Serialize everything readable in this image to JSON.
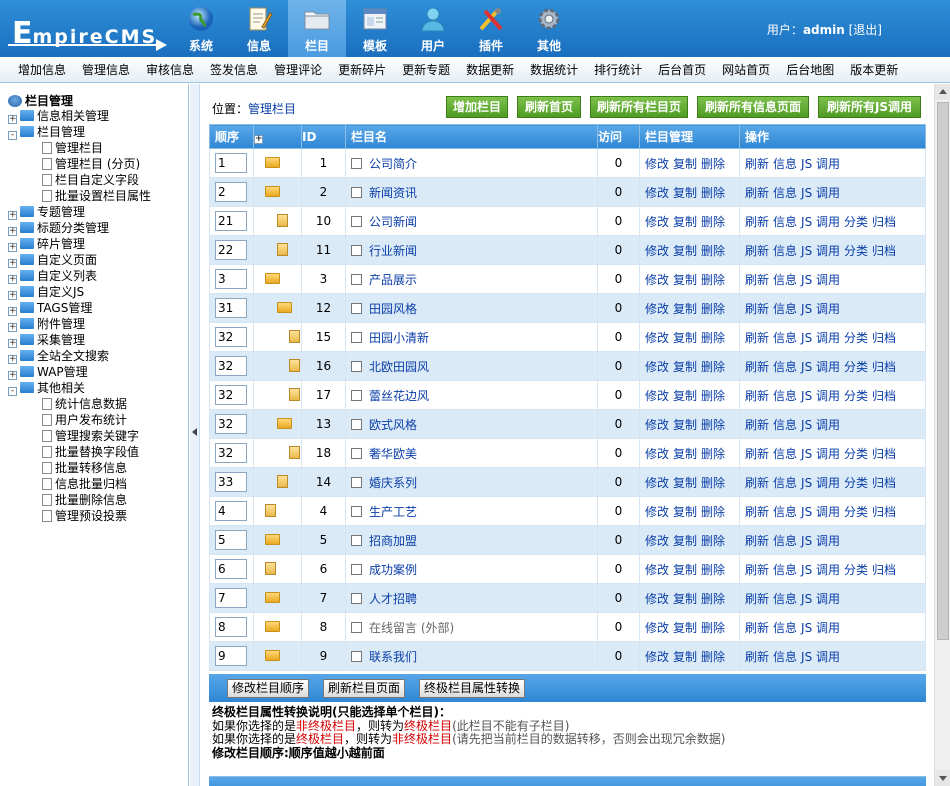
{
  "logo": {
    "text_big": "E",
    "text_rest": "mpireCMS"
  },
  "topnav": [
    {
      "label": "系统",
      "icon": "globe-icon"
    },
    {
      "label": "信息",
      "icon": "document-edit-icon"
    },
    {
      "label": "栏目",
      "icon": "folder-icon",
      "active": true
    },
    {
      "label": "模板",
      "icon": "template-window-icon"
    },
    {
      "label": "用户",
      "icon": "user-icon"
    },
    {
      "label": "插件",
      "icon": "tools-icon"
    },
    {
      "label": "其他",
      "icon": "gear-icon"
    }
  ],
  "user": {
    "label": "用户：",
    "name": "admin",
    "logout": "[退出]"
  },
  "submenu": [
    "增加信息",
    "管理信息",
    "审核信息",
    "签发信息",
    "管理评论",
    "更新碎片",
    "更新专题",
    "数据更新",
    "数据统计",
    "排行统计",
    "后台首页",
    "网站首页",
    "后台地图",
    "版本更新"
  ],
  "sidebar": {
    "title": "栏目管理",
    "items": [
      {
        "label": "信息相关管理",
        "type": "folder",
        "box": "+"
      },
      {
        "label": "栏目管理",
        "type": "folder",
        "box": "-"
      },
      {
        "label": "管理栏目",
        "type": "doc"
      },
      {
        "label": "管理栏目 (分页)",
        "type": "doc"
      },
      {
        "label": "栏目自定义字段",
        "type": "doc"
      },
      {
        "label": "批量设置栏目属性",
        "type": "doc"
      },
      {
        "label": "专题管理",
        "type": "folder",
        "box": "+"
      },
      {
        "label": "标题分类管理",
        "type": "folder",
        "box": "+"
      },
      {
        "label": "碎片管理",
        "type": "folder",
        "box": "+"
      },
      {
        "label": "自定义页面",
        "type": "folder",
        "box": "+"
      },
      {
        "label": "自定义列表",
        "type": "folder",
        "box": "+"
      },
      {
        "label": "自定义JS",
        "type": "folder",
        "box": "+"
      },
      {
        "label": "TAGS管理",
        "type": "folder",
        "box": "+"
      },
      {
        "label": "附件管理",
        "type": "folder",
        "box": "+"
      },
      {
        "label": "采集管理",
        "type": "folder",
        "box": "+"
      },
      {
        "label": "全站全文搜索",
        "type": "folder",
        "box": "+"
      },
      {
        "label": "WAP管理",
        "type": "folder",
        "box": "+"
      },
      {
        "label": "其他相关",
        "type": "folder",
        "box": "-"
      },
      {
        "label": "统计信息数据",
        "type": "doc"
      },
      {
        "label": "用户发布统计",
        "type": "doc"
      },
      {
        "label": "管理搜索关键字",
        "type": "doc"
      },
      {
        "label": "批量替换字段值",
        "type": "doc"
      },
      {
        "label": "批量转移信息",
        "type": "doc"
      },
      {
        "label": "信息批量归档",
        "type": "doc"
      },
      {
        "label": "批量删除信息",
        "type": "doc"
      },
      {
        "label": "管理预设投票",
        "type": "doc"
      }
    ]
  },
  "location": {
    "prefix": "位置：",
    "link": "管理栏目"
  },
  "actions": [
    "增加栏目",
    "刷新首页",
    "刷新所有栏目页",
    "刷新所有信息页面",
    "刷新所有JS调用"
  ],
  "table": {
    "headers": [
      "顺序",
      "+",
      "ID",
      "栏目名",
      "访问",
      "栏目管理",
      "操作"
    ],
    "manage_links": [
      "修改",
      "复制",
      "删除"
    ],
    "ops_full": [
      "刷新",
      "信息",
      "JS 调用",
      "分类",
      "归档"
    ],
    "ops_short": [
      "刷新",
      "信息",
      "JS 调用"
    ],
    "rows": [
      {
        "order": "1",
        "id": "1",
        "name": "公司简介",
        "visits": "0",
        "type": "folder",
        "level": 0,
        "full": false
      },
      {
        "order": "2",
        "id": "2",
        "name": "新闻资讯",
        "visits": "0",
        "type": "folder",
        "level": 0,
        "full": false
      },
      {
        "order": "21",
        "id": "10",
        "name": "公司新闻",
        "visits": "0",
        "type": "doc",
        "level": 1,
        "full": true
      },
      {
        "order": "22",
        "id": "11",
        "name": "行业新闻",
        "visits": "0",
        "type": "doc",
        "level": 1,
        "full": true
      },
      {
        "order": "3",
        "id": "3",
        "name": "产品展示",
        "visits": "0",
        "type": "folder",
        "level": 0,
        "full": false
      },
      {
        "order": "31",
        "id": "12",
        "name": "田园风格",
        "visits": "0",
        "type": "folder",
        "level": 1,
        "full": false
      },
      {
        "order": "32",
        "id": "15",
        "name": "田园小清新",
        "visits": "0",
        "type": "doc",
        "level": 2,
        "full": true
      },
      {
        "order": "32",
        "id": "16",
        "name": "北欧田园风",
        "visits": "0",
        "type": "doc",
        "level": 2,
        "full": true
      },
      {
        "order": "32",
        "id": "17",
        "name": "蕾丝花边风",
        "visits": "0",
        "type": "doc",
        "level": 2,
        "full": true
      },
      {
        "order": "32",
        "id": "13",
        "name": "欧式风格",
        "visits": "0",
        "type": "folder",
        "level": 1,
        "full": false
      },
      {
        "order": "32",
        "id": "18",
        "name": "奢华欧美",
        "visits": "0",
        "type": "doc",
        "level": 2,
        "full": true
      },
      {
        "order": "33",
        "id": "14",
        "name": "婚庆系列",
        "visits": "0",
        "type": "doc",
        "level": 1,
        "full": true
      },
      {
        "order": "4",
        "id": "4",
        "name": "生产工艺",
        "visits": "0",
        "type": "doc",
        "level": 0,
        "full": true
      },
      {
        "order": "5",
        "id": "5",
        "name": "招商加盟",
        "visits": "0",
        "type": "folder",
        "level": 0,
        "full": false
      },
      {
        "order": "6",
        "id": "6",
        "name": "成功案例",
        "visits": "0",
        "type": "doc",
        "level": 0,
        "full": true
      },
      {
        "order": "7",
        "id": "7",
        "name": "人才招聘",
        "visits": "0",
        "type": "folder",
        "level": 0,
        "full": false
      },
      {
        "order": "8",
        "id": "8",
        "name": "在线留言 (外部)",
        "visits": "0",
        "type": "folder",
        "level": 0,
        "full": false,
        "gray": true
      },
      {
        "order": "9",
        "id": "9",
        "name": "联系我们",
        "visits": "0",
        "type": "folder",
        "level": 0,
        "full": false
      }
    ]
  },
  "bottom_buttons": [
    "修改栏目顺序",
    "刷新栏目页面",
    "终极栏目属性转换"
  ],
  "notes": {
    "title": "终极栏目属性转换说明(只能选择单个栏目)：",
    "line1_a": "如果你选择的是",
    "line1_b": "非终极栏目",
    "line1_c": "，则转为",
    "line1_d": "终极栏目",
    "line1_e": "(此栏目不能有子栏目)",
    "line2_a": "如果你选择的是",
    "line2_b": "终极栏目",
    "line2_c": "，则转为",
    "line2_d": "非终极栏目",
    "line2_e": "(请先把当前栏目的数据转移，否则会出现冗余数据)",
    "line3": "修改栏目顺序:顺序值越小越前面"
  }
}
